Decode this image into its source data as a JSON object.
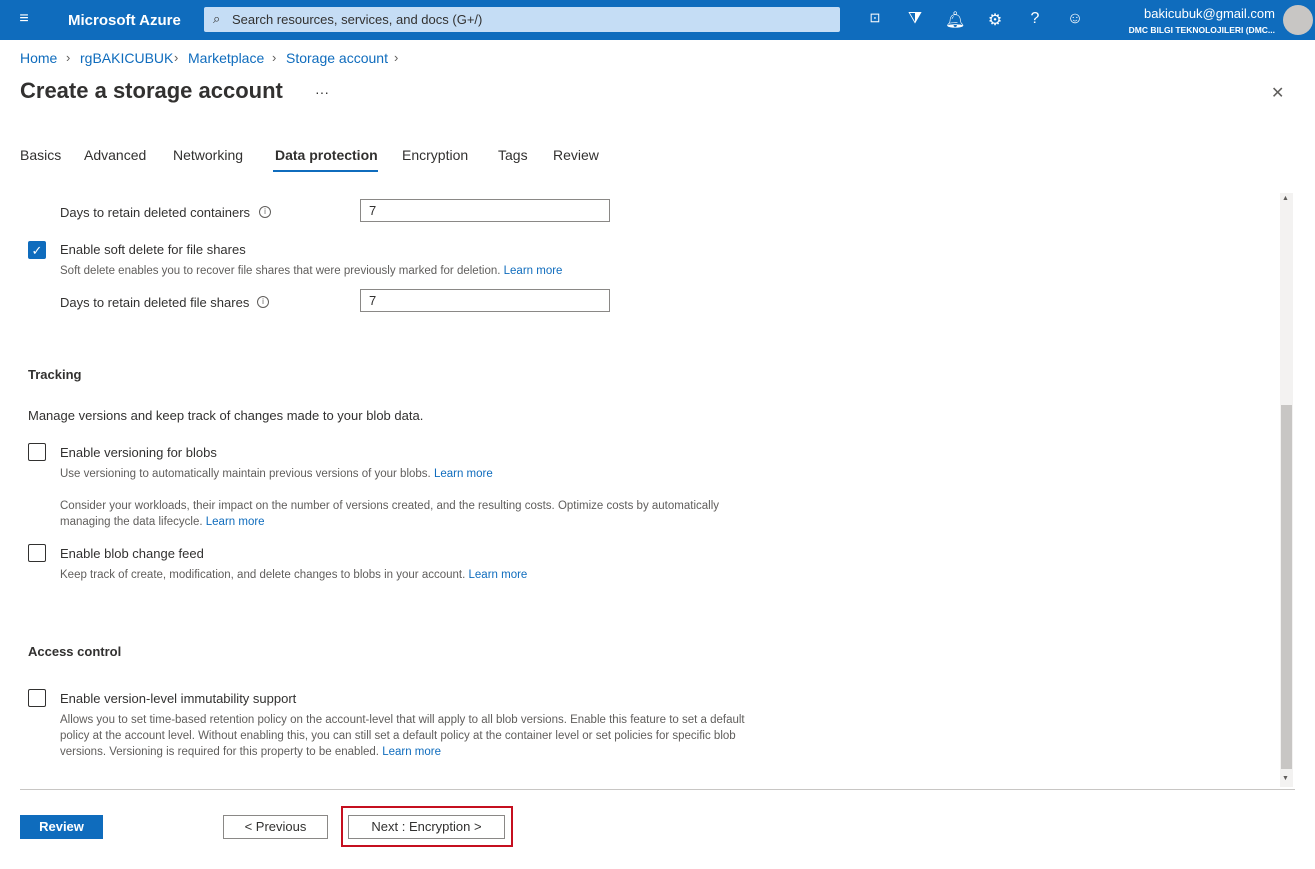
{
  "header": {
    "menu_icon": "hamburger-icon",
    "brand": "Microsoft Azure",
    "search_placeholder": "Search resources, services, and docs (G+/)",
    "user_email": "bakicubuk@gmail.com",
    "user_org": "DMC BILGI TEKNOLOJILERI (DMC..."
  },
  "breadcrumb": [
    "Home",
    "rgBAKICUBUK",
    "Marketplace",
    "Storage account"
  ],
  "page": {
    "title": "Create a storage account",
    "more": "···",
    "close": "✕"
  },
  "tabs": [
    "Basics",
    "Advanced",
    "Networking",
    "Data protection",
    "Encryption",
    "Tags",
    "Review"
  ],
  "active_tab": "Data protection",
  "form": {
    "containers_days_label": "Days to retain deleted containers",
    "containers_days_value": "7",
    "file_shares_label": "Enable soft delete for file shares",
    "file_shares_checked": true,
    "file_shares_desc": "Soft delete enables you to recover file shares that were previously marked for deletion.",
    "file_shares_days_label": "Days to retain deleted file shares",
    "file_shares_days_value": "7",
    "tracking_heading": "Tracking",
    "tracking_desc": "Manage versions and keep track of changes made to your blob data.",
    "versioning_label": "Enable versioning for blobs",
    "versioning_checked": false,
    "versioning_desc": "Use versioning to automatically maintain previous versions of your blobs.",
    "versioning_desc2": "Consider your workloads, their impact on the number of versions created, and the resulting costs. Optimize costs by automatically managing the data lifecycle.",
    "change_feed_label": "Enable blob change feed",
    "change_feed_checked": false,
    "change_feed_desc": "Keep track of create, modification, and delete changes to blobs in your account.",
    "access_heading": "Access control",
    "immutability_label": "Enable version-level immutability support",
    "immutability_checked": false,
    "immutability_desc": "Allows you to set time-based retention policy on the account-level that will apply to all blob versions. Enable this feature to set a default policy at the account level. Without enabling this, you can still set a default policy at the container level or set policies for specific blob versions. Versioning is required for this property to be enabled.",
    "learn_more": "Learn more"
  },
  "footer": {
    "review": "Review",
    "previous": "< Previous",
    "next": "Next : Encryption >"
  },
  "colors": {
    "accent": "#0f6cbd",
    "highlight": "#c50f1f"
  }
}
